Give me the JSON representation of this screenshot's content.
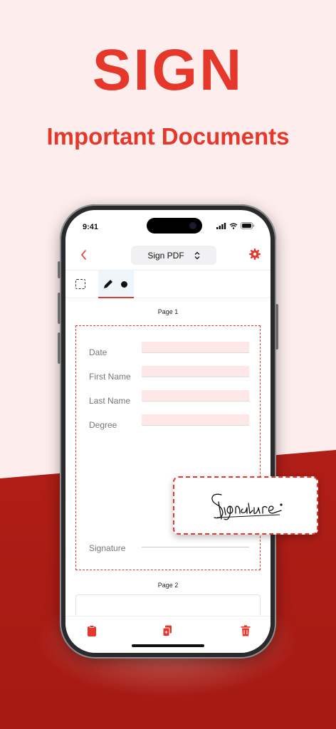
{
  "hero": {
    "title": "SIGN",
    "subtitle": "Important Documents"
  },
  "colors": {
    "accent": "#e5382b",
    "background": "#fdeeed",
    "bottom_background": "#b01f17"
  },
  "status_bar": {
    "time": "9:41",
    "icons": [
      "cellular-signal-icon",
      "wifi-icon",
      "battery-icon"
    ]
  },
  "navbar": {
    "back_icon": "chevron-left-icon",
    "document_selector": "Sign PDF",
    "selector_icon": "chevron-up-down-icon",
    "settings_icon": "gear-icon"
  },
  "toolbar": {
    "tools": [
      "selection-tool-icon",
      "pen-icon"
    ],
    "active_tool": "pen-icon"
  },
  "document": {
    "page1_label": "Page 1",
    "page2_label": "Page 2",
    "fields": [
      {
        "label": "Date"
      },
      {
        "label": "First  Name"
      },
      {
        "label": "Last Name"
      },
      {
        "label": "Degree"
      }
    ],
    "signature_label": "Signature"
  },
  "signature_card": {
    "text": "Signature"
  },
  "bottom_bar": {
    "icons": [
      "clipboard-icon",
      "copy-icon",
      "trash-icon"
    ]
  }
}
